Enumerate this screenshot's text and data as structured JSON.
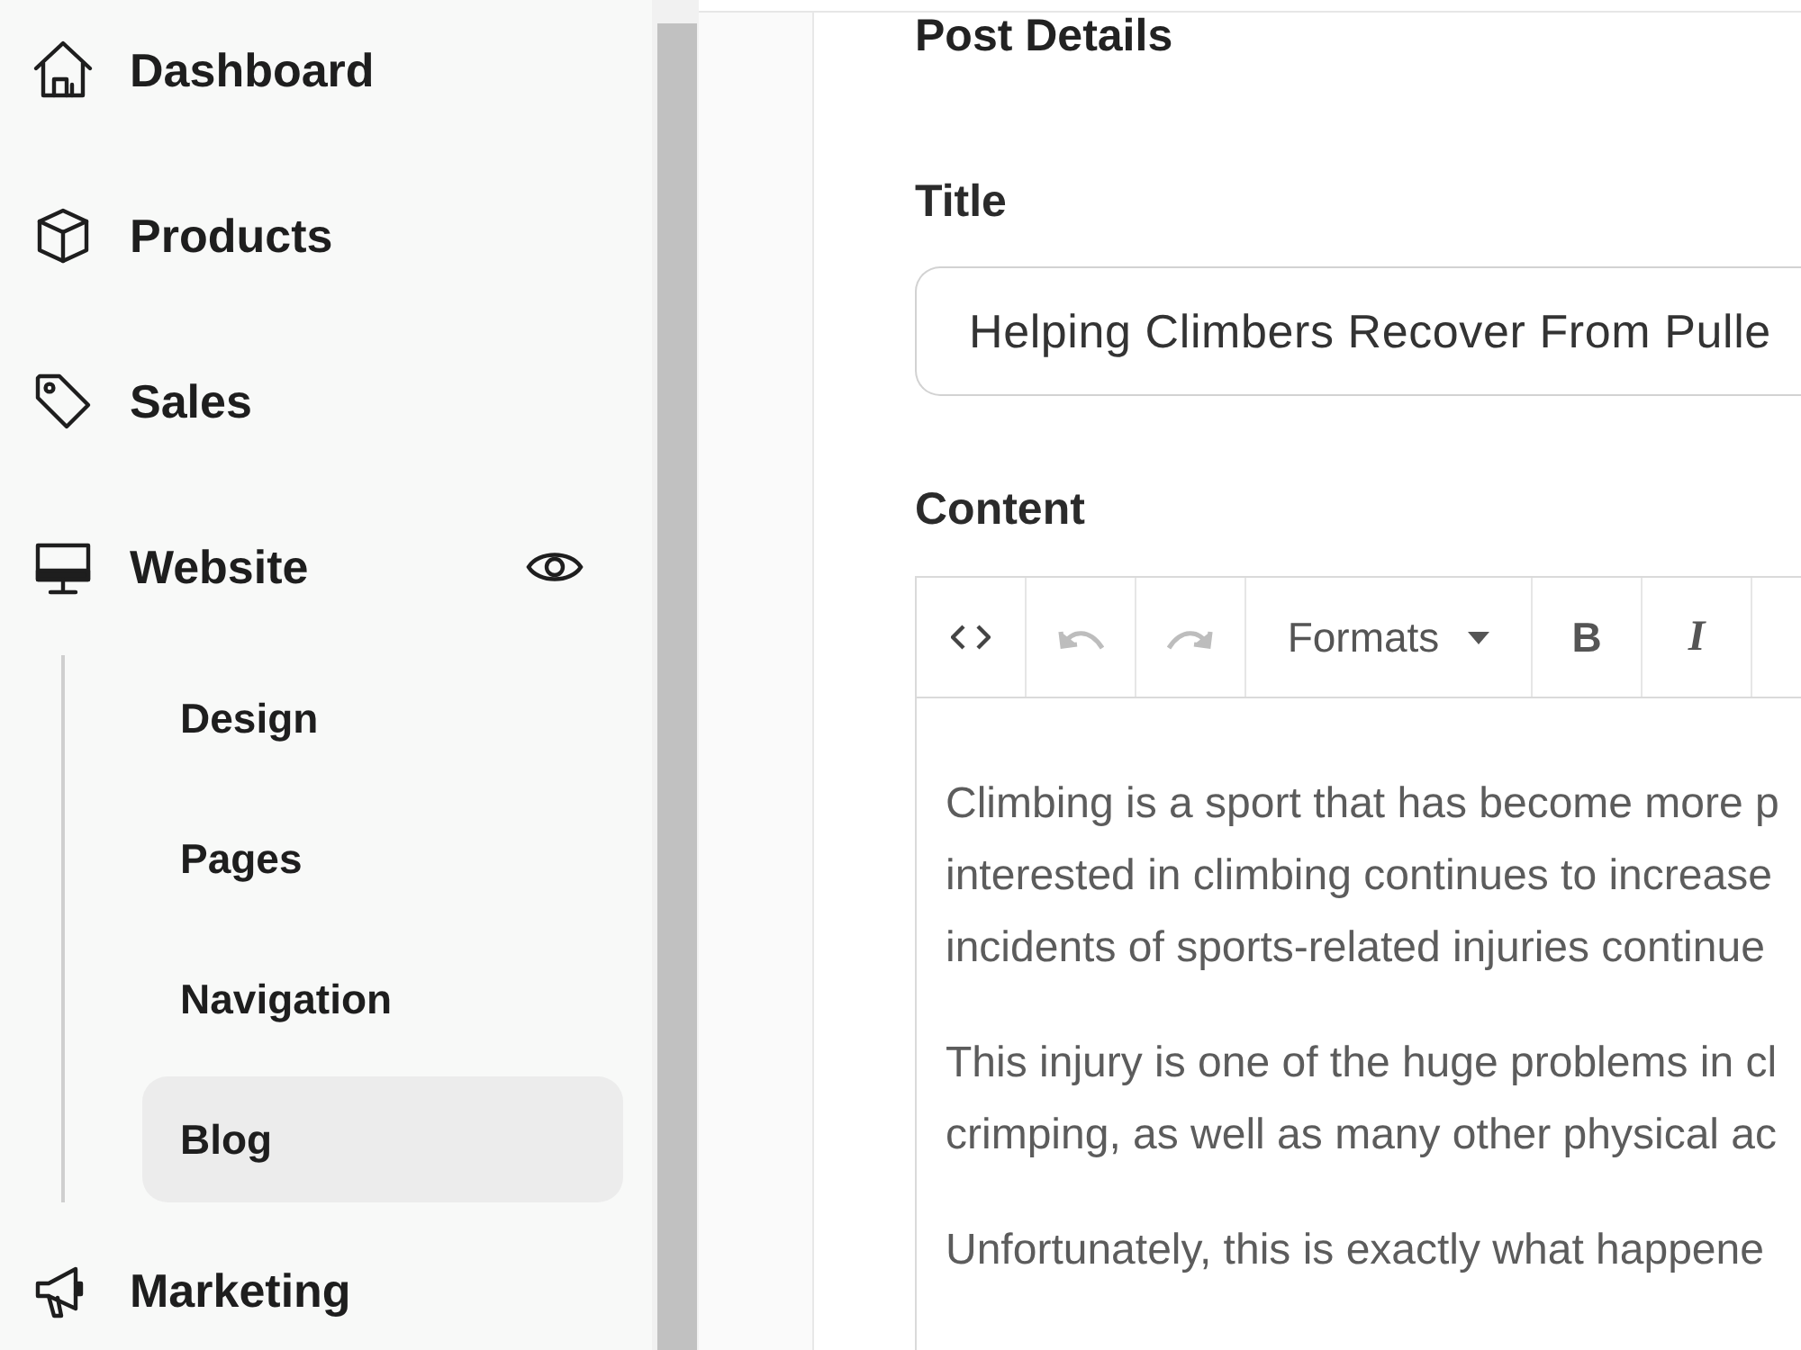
{
  "sidebar": {
    "items": [
      {
        "label": "Dashboard"
      },
      {
        "label": "Products"
      },
      {
        "label": "Sales"
      },
      {
        "label": "Website",
        "children": [
          {
            "label": "Design",
            "selected": false
          },
          {
            "label": "Pages",
            "selected": false
          },
          {
            "label": "Navigation",
            "selected": false
          },
          {
            "label": "Blog",
            "selected": true
          }
        ]
      },
      {
        "label": "Marketing"
      }
    ]
  },
  "post": {
    "heading": "Post Details",
    "title_label": "Title",
    "title_value": "Helping Climbers Recover From Pulle",
    "content_label": "Content",
    "editor": {
      "toolbar": [
        {
          "kind": "code",
          "disabled": false
        },
        {
          "kind": "undo",
          "disabled": true
        },
        {
          "kind": "redo",
          "disabled": true
        },
        {
          "kind": "dropdown",
          "label": "Formats",
          "disabled": false
        },
        {
          "kind": "bold",
          "label": "B",
          "disabled": false
        },
        {
          "kind": "italic",
          "label": "I",
          "disabled": false
        }
      ],
      "paragraphs": [
        {
          "lines": [
            "Climbing is a sport that has become more p",
            "interested in climbing continues to increase",
            "incidents of sports-related injuries continue"
          ]
        },
        {
          "lines": [
            "This injury is one of the huge problems in cl",
            "crimping, as well as many other physical ac"
          ]
        },
        {
          "lines": [
            "Unfortunately, this is exactly what happene"
          ]
        }
      ]
    }
  }
}
